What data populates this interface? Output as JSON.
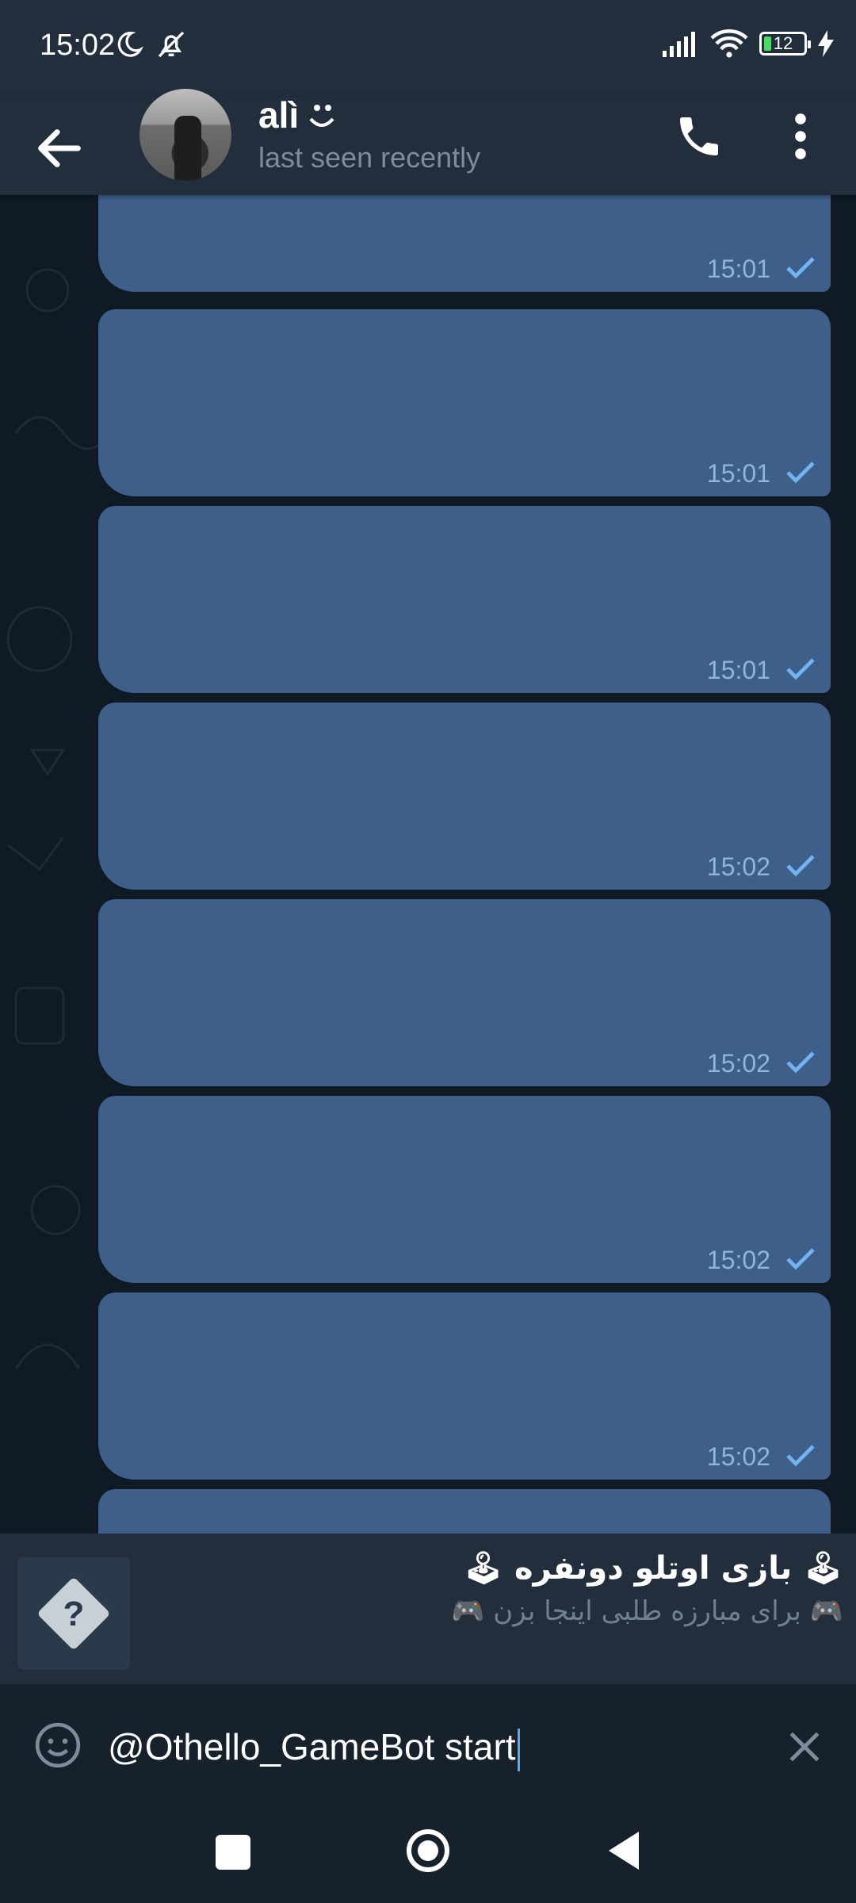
{
  "status_bar": {
    "time": "15:02",
    "battery": "12"
  },
  "header": {
    "contact_name": "alì",
    "contact_status": "last seen recently"
  },
  "messages": [
    {
      "time": "15:01"
    },
    {
      "time": "15:01"
    },
    {
      "time": "15:01"
    },
    {
      "time": "15:02"
    },
    {
      "time": "15:02"
    },
    {
      "time": "15:02"
    },
    {
      "time": "15:02"
    }
  ],
  "inline_result": {
    "title": "🕹 بازی اوتلو دونفره 🕹",
    "description": "🎮 برای مبارزه طلبی اینجا بزن 🎮",
    "thumb_icon": "question-diamond-icon"
  },
  "composer": {
    "text": "@Othello_GameBot start"
  },
  "colors": {
    "header_bg": "#232e3c",
    "bubble_out": "#3e5f8a",
    "chat_bg": "#0f1a25",
    "accent": "#5ea8ec"
  }
}
